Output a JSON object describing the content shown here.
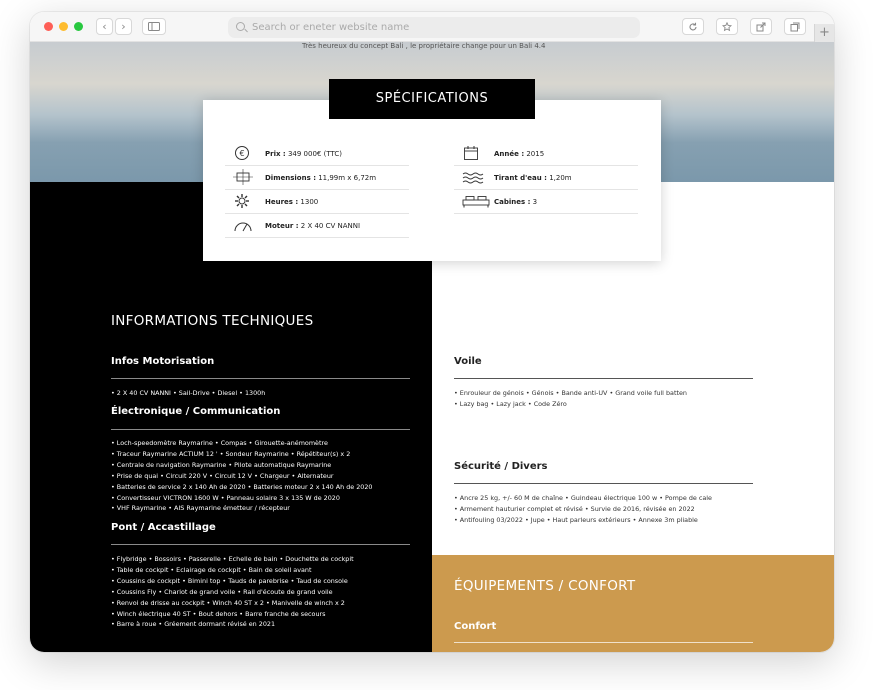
{
  "browser": {
    "url_placeholder": "Search or eneter website name",
    "back_label": "‹",
    "forward_label": "›",
    "new_tab_label": "+"
  },
  "hero": {
    "caption": "Très heureux du concept Bali , le propriétaire change pour un Bali 4.4"
  },
  "specs": {
    "title": "SPÉCIFICATIONS",
    "left": [
      {
        "label": "Prix :",
        "value": " 349 000€ (TTC)",
        "icon": "euro-icon"
      },
      {
        "label": "Dimensions :",
        "value": " 11,99m x 6,72m",
        "icon": "dimensions-icon"
      },
      {
        "label": "Heures :",
        "value": " 1300",
        "icon": "gear-icon"
      },
      {
        "label": "Moteur :",
        "value": " 2 X 40 CV NANNI",
        "icon": "gauge-icon"
      }
    ],
    "right": [
      {
        "label": "Année :",
        "value": " 2015",
        "icon": "calendar-icon"
      },
      {
        "label": "Tirant d'eau :",
        "value": " 1,20m",
        "icon": "waves-icon"
      },
      {
        "label": "Cabines :",
        "value": " 3",
        "icon": "bed-icon"
      }
    ]
  },
  "tech": {
    "title": "INFORMATIONS TECHNIQUES",
    "motor": {
      "title": "Infos Motorisation",
      "lines": [
        "• 2 X 40 CV NANNI   • Sail-Drive   • Diesel   • 1300h"
      ]
    },
    "electronics": {
      "title": "Électronique / Communication",
      "lines": [
        "• Loch-speedomètre Raymarine   • Compas   • Girouette-anémomètre",
        "• Traceur Raymarine ACTIUM 12 '   • Sondeur Raymarine   • Répétiteur(s) x 2",
        "• Centrale de navigation Raymarine   • Pilote automatique Raymarine",
        "• Prise de quai   • Circuit 220 V   • Circuit 12 V   • Chargeur   • Alternateur",
        "• Batteries de service 2 x 140 Ah de 2020   • Batteries moteur 2 x 140 Ah de 2020",
        "• Convertisseur VICTRON 1600 W   • Panneau solaire 3 x 135 W de 2020",
        "• VHF Raymarine   • AIS Raymarine émetteur / récepteur"
      ]
    },
    "deck": {
      "title": "Pont / Accastillage",
      "lines": [
        "• Flybridge   • Bossoirs   • Passerelle   • Echelle de bain   • Douchette de cockpit",
        "• Table de cockpit   • Eclairage de cockpit   • Bain de soleil avant",
        "• Coussins de cockpit   • Bimini top   • Tauds de parebrise   • Taud de console",
        "• Coussins Fly   • Chariot de grand voile   • Rail d'écoute de grand voile",
        "• Renvoi de drisse au cockpit   • Winch 40 ST x 2   • Manivelle de winch x 2",
        "• Winch électrique 40 ST   • Bout dehors   • Barre franche de secours",
        "• Barre à roue   • Gréement dormant révisé en 2021"
      ]
    }
  },
  "sail": {
    "title": "Voile",
    "lines": [
      "• Enrouleur de génois   • Génois   • Bande anti-UV   • Grand voile full batten",
      "• Lazy bag   • Lazy jack   • Code Zéro"
    ]
  },
  "security": {
    "title": "Sécurité / Divers",
    "lines": [
      "• Ancre 25 kg, +/- 60 M de chaîne   • Guindeau électrique 100 w   • Pompe de cale",
      "• Armement hauturier complet et révisé   • Survie de 2016, révisée en 2022",
      "• Antifouling 03/2022   • Jupe   • Haut parleurs extérieurs   • Annexe 3m pliable"
    ]
  },
  "comfort": {
    "title": "ÉQUIPEMENTS / CONFORT",
    "subtitle": "Confort"
  },
  "colors": {
    "gold": "#cc9a4e",
    "dark": "#000000"
  }
}
